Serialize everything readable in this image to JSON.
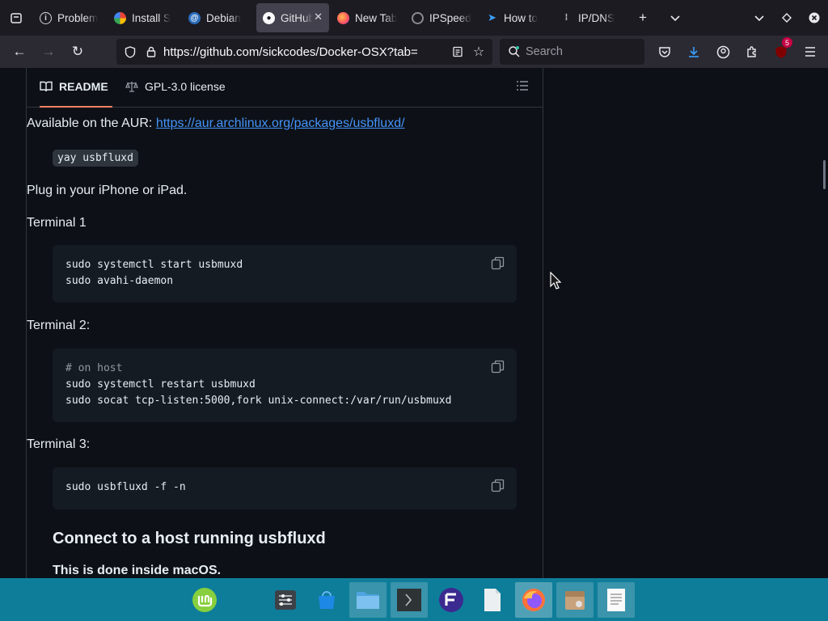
{
  "browser": {
    "tabs": [
      {
        "label": "Problem",
        "favicon": "info-icon",
        "active": false
      },
      {
        "label": "Install S",
        "favicon": "google-icon",
        "active": false
      },
      {
        "label": "Debian",
        "favicon": "debian-icon",
        "active": false
      },
      {
        "label": "GitHub",
        "favicon": "github-icon",
        "active": true
      },
      {
        "label": "New Tab",
        "favicon": "firefox-icon",
        "active": false
      },
      {
        "label": "IPSpeed",
        "favicon": "ipspeed-icon",
        "active": false
      },
      {
        "label": "How to",
        "favicon": "bird-icon",
        "active": false
      },
      {
        "label": "IP/DNS",
        "favicon": "signal-icon",
        "active": false
      }
    ],
    "url": "https://github.com/sickcodes/Docker-OSX?tab=",
    "search_placeholder": "Search",
    "extension_badge": "5"
  },
  "readme": {
    "tab_readme": "README",
    "tab_license": "GPL-3.0 license",
    "aur_text": "Available on the AUR: ",
    "aur_link": "https://aur.archlinux.org/packages/usbfluxd/",
    "inline_cmd": "yay usbfluxd",
    "plug_text": "Plug in your iPhone or iPad.",
    "terminal1_label": "Terminal 1",
    "terminal1_lines": [
      "sudo systemctl start usbmuxd",
      "sudo avahi-daemon"
    ],
    "terminal2_label": "Terminal 2:",
    "terminal2_comment": "# on host",
    "terminal2_lines": [
      "sudo systemctl restart usbmuxd",
      "sudo socat tcp-listen:5000,fork unix-connect:/var/run/usbmuxd"
    ],
    "terminal3_label": "Terminal 3:",
    "terminal3_lines": [
      "sudo usbfluxd -f -n"
    ],
    "heading": "Connect to a host running usbfluxd",
    "macos_note": "This is done inside macOS."
  },
  "taskbar": {
    "items": [
      "mint-menu-icon",
      "settings-icon",
      "software-store-icon",
      "files-icon",
      "terminal-icon",
      "vpn-icon",
      "text-file-icon",
      "firefox-icon",
      "archive-icon",
      "text-editor-icon"
    ]
  },
  "colors": {
    "accent_link": "#4493f8",
    "active_underline": "#f78166",
    "taskbar": "#0e7d9a"
  }
}
